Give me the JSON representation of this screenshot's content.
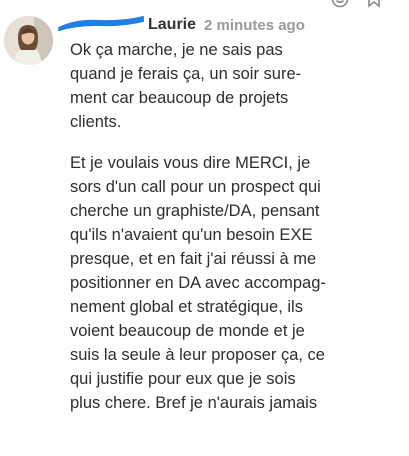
{
  "message": {
    "author": "Laurie",
    "timestamp": "2 minutes ago",
    "paragraphs": [
      "Ok ça marche, je ne sais pas\nquand je ferais ça, un soir sure-\nment car beaucoup de projets\nclients.",
      "Et je voulais vous dire MERCI, je\nsors d'un call pour un prospect qui\ncherche un graphiste/DA, pensant\nqu'ils n'avaient qu'un besoin EXE\npresque, et en fait j'ai réussi à me\npositionner en DA avec accompag-\nnement global et stratégique, ils\nvoient beaucoup de monde et je\nsuis la seule à leur proposer ça, ce\nqui justifie pour eux que je sois\nplus chere. Bref je n'aurais jamais"
    ]
  },
  "actions": [
    {
      "icon": "smile-icon"
    },
    {
      "icon": "bookmark-icon"
    }
  ],
  "colors": {
    "text": "#2e2e2e",
    "timestamp": "#9a9a9a",
    "redaction": "#1e7fe6"
  }
}
